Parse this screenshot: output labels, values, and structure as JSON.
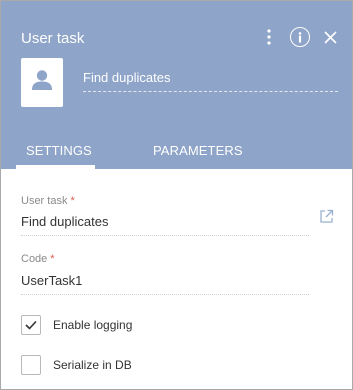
{
  "header": {
    "title": "User task",
    "task_name": "Find duplicates",
    "icons": [
      "kebab-menu-icon",
      "info-icon",
      "close-icon",
      "user-avatar-icon"
    ]
  },
  "tabs": [
    {
      "label": "SETTINGS",
      "active": true
    },
    {
      "label": "PARAMETERS",
      "active": false
    }
  ],
  "fields": {
    "user_task": {
      "label": "User task",
      "required_mark": "*",
      "value": "Find duplicates"
    },
    "code": {
      "label": "Code",
      "required_mark": "*",
      "value": "UserTask1"
    }
  },
  "checkboxes": [
    {
      "label": "Enable logging",
      "checked": true
    },
    {
      "label": "Serialize in DB",
      "checked": false
    }
  ],
  "colors": {
    "header_bg": "#8ea4c8",
    "required": "#e05a4f",
    "border": "#a9a9a9"
  }
}
